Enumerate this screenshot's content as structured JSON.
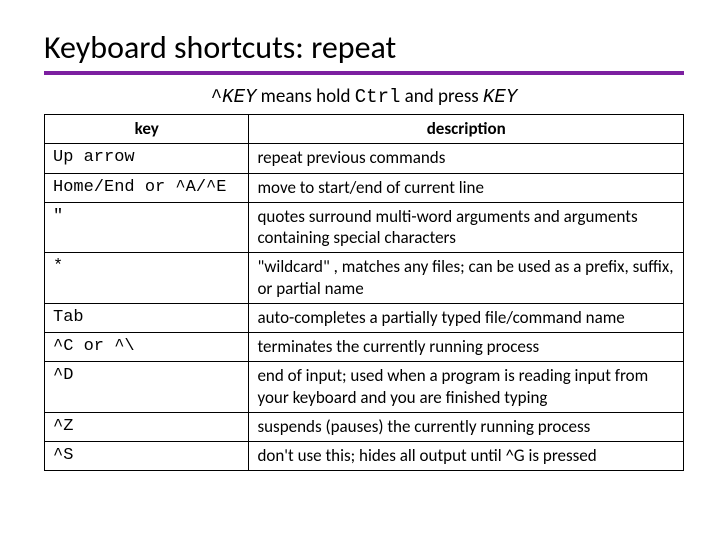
{
  "title": "Keyboard shortcuts: repeat",
  "subtitle": {
    "prefix": "^",
    "key1": "KEY",
    "mid": " means hold ",
    "ctrl": "Ctrl",
    "and": " and press ",
    "key2": "KEY"
  },
  "headers": {
    "key": "key",
    "description": "description"
  },
  "rows": [
    {
      "key": "Up arrow",
      "desc": "repeat previous commands"
    },
    {
      "key": "Home/End or ^A/^E",
      "desc": "move to start/end of current line"
    },
    {
      "key": "\"",
      "desc": "quotes surround multi-word arguments and arguments containing special characters"
    },
    {
      "key": "*",
      "desc": "\"wildcard\" , matches any files;\ncan be used as a prefix, suffix, or partial name"
    },
    {
      "key": "Tab",
      "desc": "auto-completes a partially typed file/command name"
    },
    {
      "key": "^C or ^\\",
      "desc": "terminates the currently running process"
    },
    {
      "key": "^D",
      "desc": "end of input; used when a program is reading input from your keyboard and you are finished typing"
    },
    {
      "key": "^Z",
      "desc": "suspends (pauses) the currently running process"
    },
    {
      "key": "^S",
      "desc": "don't use this; hides all output until ^G is pressed"
    }
  ]
}
